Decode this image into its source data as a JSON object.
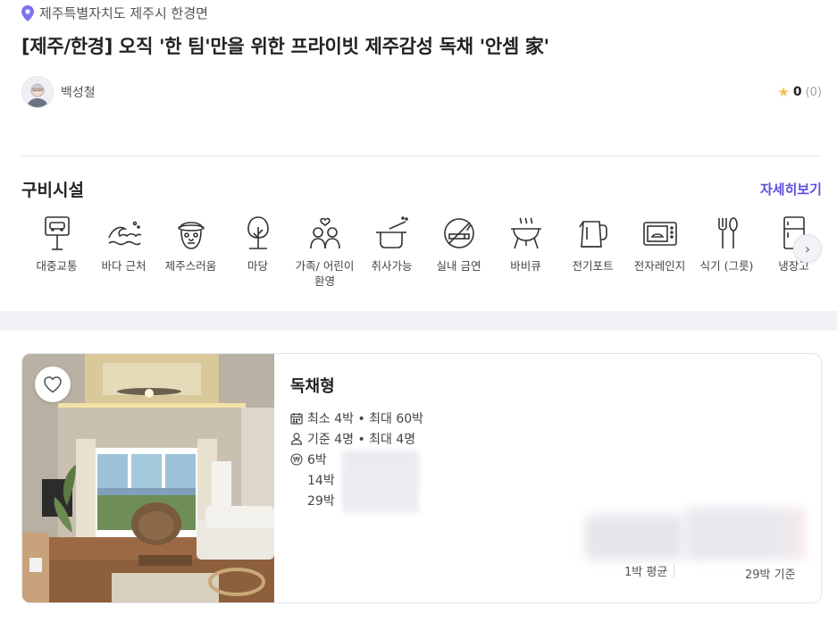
{
  "location": "제주특별자치도 제주시 한경면",
  "title": "[제주/한경] 오직 '한 팀'만을 위한 프라이빗 제주감성 독채 '안셈 家'",
  "host": {
    "name": "백성철"
  },
  "rating": {
    "score": "0",
    "count": "(0)"
  },
  "amenities": {
    "title": "구비시설",
    "more_label": "자세히보기",
    "items": [
      {
        "label": "대중교통",
        "icon": "bus-stop-icon"
      },
      {
        "label": "바다 근처",
        "icon": "sea-wave-icon"
      },
      {
        "label": "제주스러움",
        "icon": "dolharubang-icon"
      },
      {
        "label": "마당",
        "icon": "tree-icon"
      },
      {
        "label": "가족/ 어린이 환영",
        "icon": "family-icon"
      },
      {
        "label": "취사가능",
        "icon": "cooking-pot-icon"
      },
      {
        "label": "실내 금연",
        "icon": "no-smoking-icon"
      },
      {
        "label": "바비큐",
        "icon": "bbq-grill-icon"
      },
      {
        "label": "전기포트",
        "icon": "electric-kettle-icon"
      },
      {
        "label": "전자레인지",
        "icon": "microwave-icon"
      },
      {
        "label": "식기 (그릇)",
        "icon": "cutlery-icon"
      },
      {
        "label": "냉장고",
        "icon": "refrigerator-icon"
      }
    ]
  },
  "room": {
    "name": "독채형",
    "stay_range": "최소 4박 • 최대 60박",
    "guests": "기준 4명 • 최대 4명",
    "nights": [
      "6박",
      "14박",
      "29박"
    ],
    "avg_label": "1박 평균",
    "base_label": "29박 기준"
  },
  "colors": {
    "accent": "#5b4fe0",
    "pin": "#7c74f0",
    "star": "#f5c046"
  }
}
